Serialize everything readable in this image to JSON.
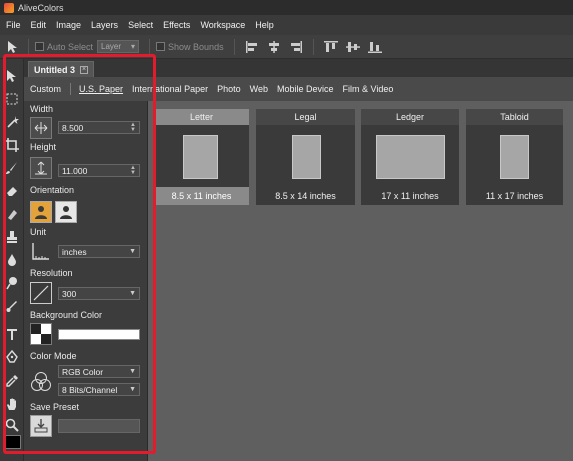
{
  "app": {
    "title": "AliveColors"
  },
  "menu": [
    "File",
    "Edit",
    "Image",
    "Layers",
    "Select",
    "Effects",
    "Workspace",
    "Help"
  ],
  "options_bar": {
    "auto_select_label": "Auto Select",
    "layer_value": "Layer",
    "show_bounds_label": "Show Bounds"
  },
  "document": {
    "tab_label": "Untitled 3"
  },
  "preset_tabs": [
    "Custom",
    "U.S. Paper",
    "International Paper",
    "Photo",
    "Web",
    "Mobile Device",
    "Film & Video"
  ],
  "active_preset_tab": "U.S. Paper",
  "panel": {
    "width_label": "Width",
    "width_value": "8.500",
    "height_label": "Height",
    "height_value": "11.000",
    "orientation_label": "Orientation",
    "unit_label": "Unit",
    "unit_value": "inches",
    "resolution_label": "Resolution",
    "resolution_value": "300",
    "bg_color_label": "Background Color",
    "bg_color": "#ffffff",
    "color_mode_label": "Color Mode",
    "color_mode_value": "RGB Color",
    "bit_depth_value": "8 Bits/Channel",
    "save_preset_label": "Save Preset"
  },
  "presets": [
    {
      "name": "Letter",
      "size": "8.5 x 11 inches",
      "selected": true
    },
    {
      "name": "Legal",
      "size": "8.5 x 14 inches",
      "selected": false
    },
    {
      "name": "Ledger",
      "size": "17 x 11 inches",
      "selected": false
    },
    {
      "name": "Tabloid",
      "size": "11 x 17 inches",
      "selected": false
    }
  ],
  "colors": {
    "highlight": "#e31b2c",
    "foreground_swatch": "#000000"
  }
}
